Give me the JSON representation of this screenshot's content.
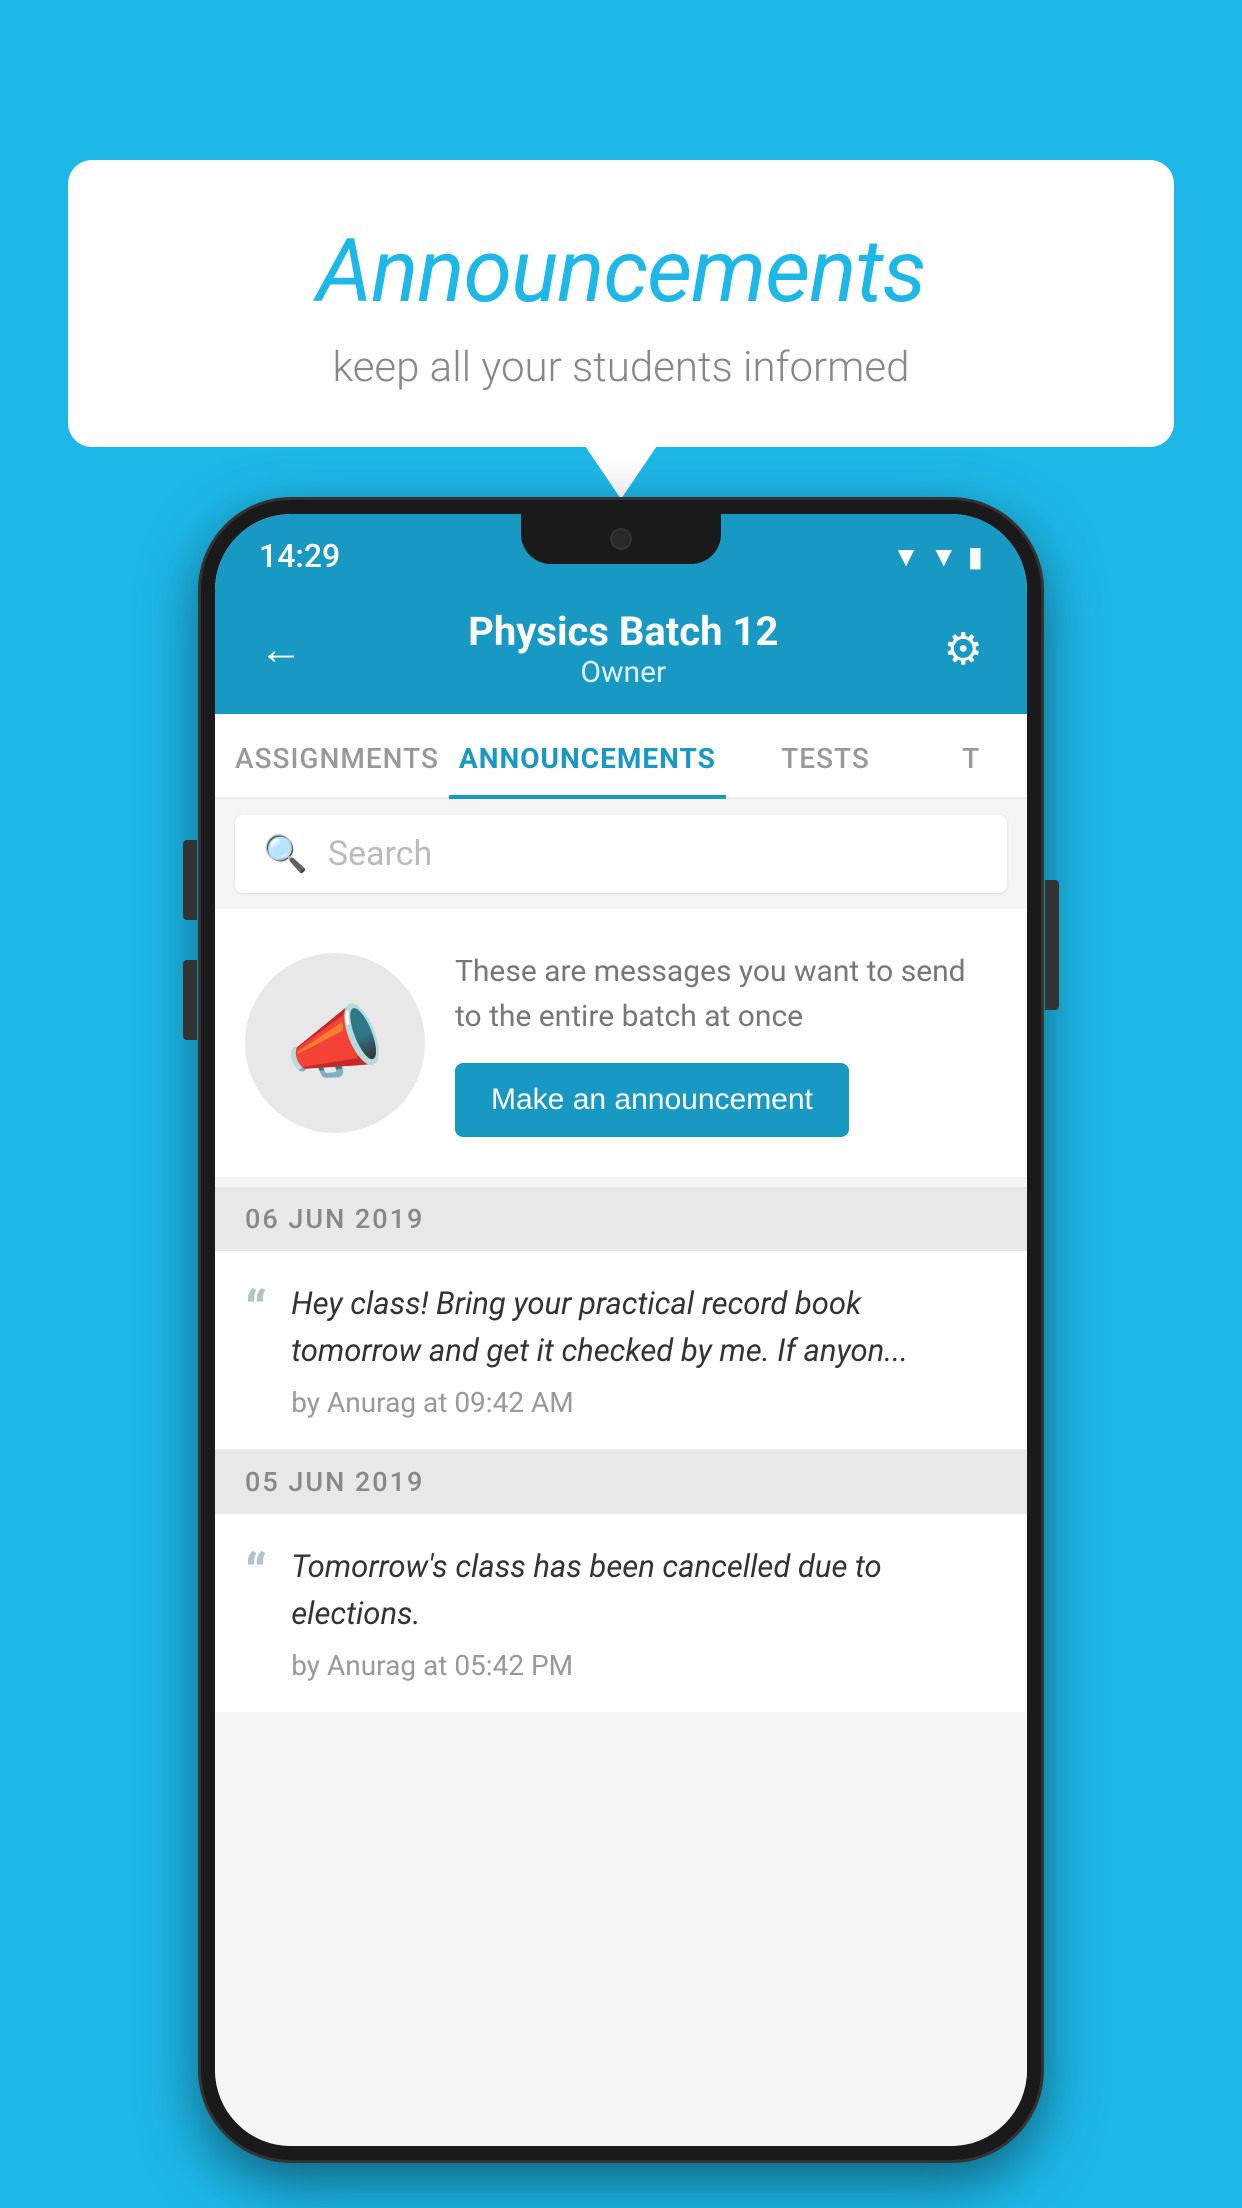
{
  "background_color": "#1DB8E8",
  "speech_bubble": {
    "title": "Announcements",
    "subtitle": "keep all your students informed"
  },
  "phone": {
    "status_bar": {
      "time": "14:29",
      "wifi": "▲",
      "signal": "▲",
      "battery": "▮"
    },
    "header": {
      "back_label": "←",
      "title": "Physics Batch 12",
      "subtitle": "Owner",
      "settings_label": "⚙"
    },
    "tabs": [
      {
        "label": "ASSIGNMENTS",
        "active": false
      },
      {
        "label": "ANNOUNCEMENTS",
        "active": true
      },
      {
        "label": "TESTS",
        "active": false
      },
      {
        "label": "T",
        "active": false,
        "partial": true
      }
    ],
    "search": {
      "placeholder": "Search"
    },
    "promo": {
      "description": "These are messages you want to send to the entire batch at once",
      "button_label": "Make an announcement"
    },
    "announcements": [
      {
        "date": "06  JUN  2019",
        "message": "Hey class! Bring your practical record book tomorrow and get it checked by me. If anyon...",
        "meta": "by Anurag at 09:42 AM"
      },
      {
        "date": "05  JUN  2019",
        "message": "Tomorrow's class has been cancelled due to elections.",
        "meta": "by Anurag at 05:42 PM"
      }
    ]
  }
}
